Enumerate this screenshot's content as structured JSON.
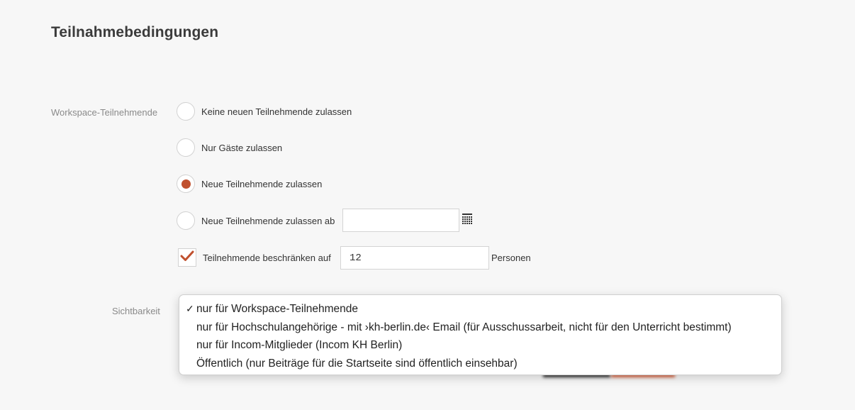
{
  "page": {
    "title": "Teilnahmebedingungen"
  },
  "workspace_participants": {
    "label": "Workspace-Teilnehmende",
    "options": [
      {
        "label": "Keine neuen Teilnehmende zulassen",
        "selected": false
      },
      {
        "label": "Nur Gäste zulassen",
        "selected": false
      },
      {
        "label": "Neue Teilnehmende zulassen",
        "selected": true
      },
      {
        "label": "Neue Teilnehmende zulassen ab",
        "selected": false
      }
    ],
    "date_input": {
      "value": "",
      "placeholder": ""
    },
    "limit": {
      "checked": true,
      "label": "Teilnehmende beschränken auf",
      "value": "12",
      "unit": "Personen"
    }
  },
  "visibility": {
    "label": "Sichtbarkeit",
    "options": [
      {
        "label": "nur für Workspace-Teilnehmende",
        "selected": true
      },
      {
        "label": "nur für Hochschulangehörige - mit ›kh-berlin.de‹ Email (für Ausschussarbeit, nicht für den Unterricht bestimmt)",
        "selected": false
      },
      {
        "label": "nur für Incom-Mitglieder (Incom KH Berlin)",
        "selected": false
      },
      {
        "label": "Öffentlich (nur Beiträge für die Startseite sind öffentlich einsehbar)",
        "selected": false
      }
    ],
    "check_glyph": "✓"
  },
  "colors": {
    "accent": "#c0502e",
    "label_gray": "#8a8a8a",
    "background": "#f7f7f7"
  },
  "icons": {
    "calendar": "calendar-icon",
    "checkmark": "checkmark-icon"
  }
}
